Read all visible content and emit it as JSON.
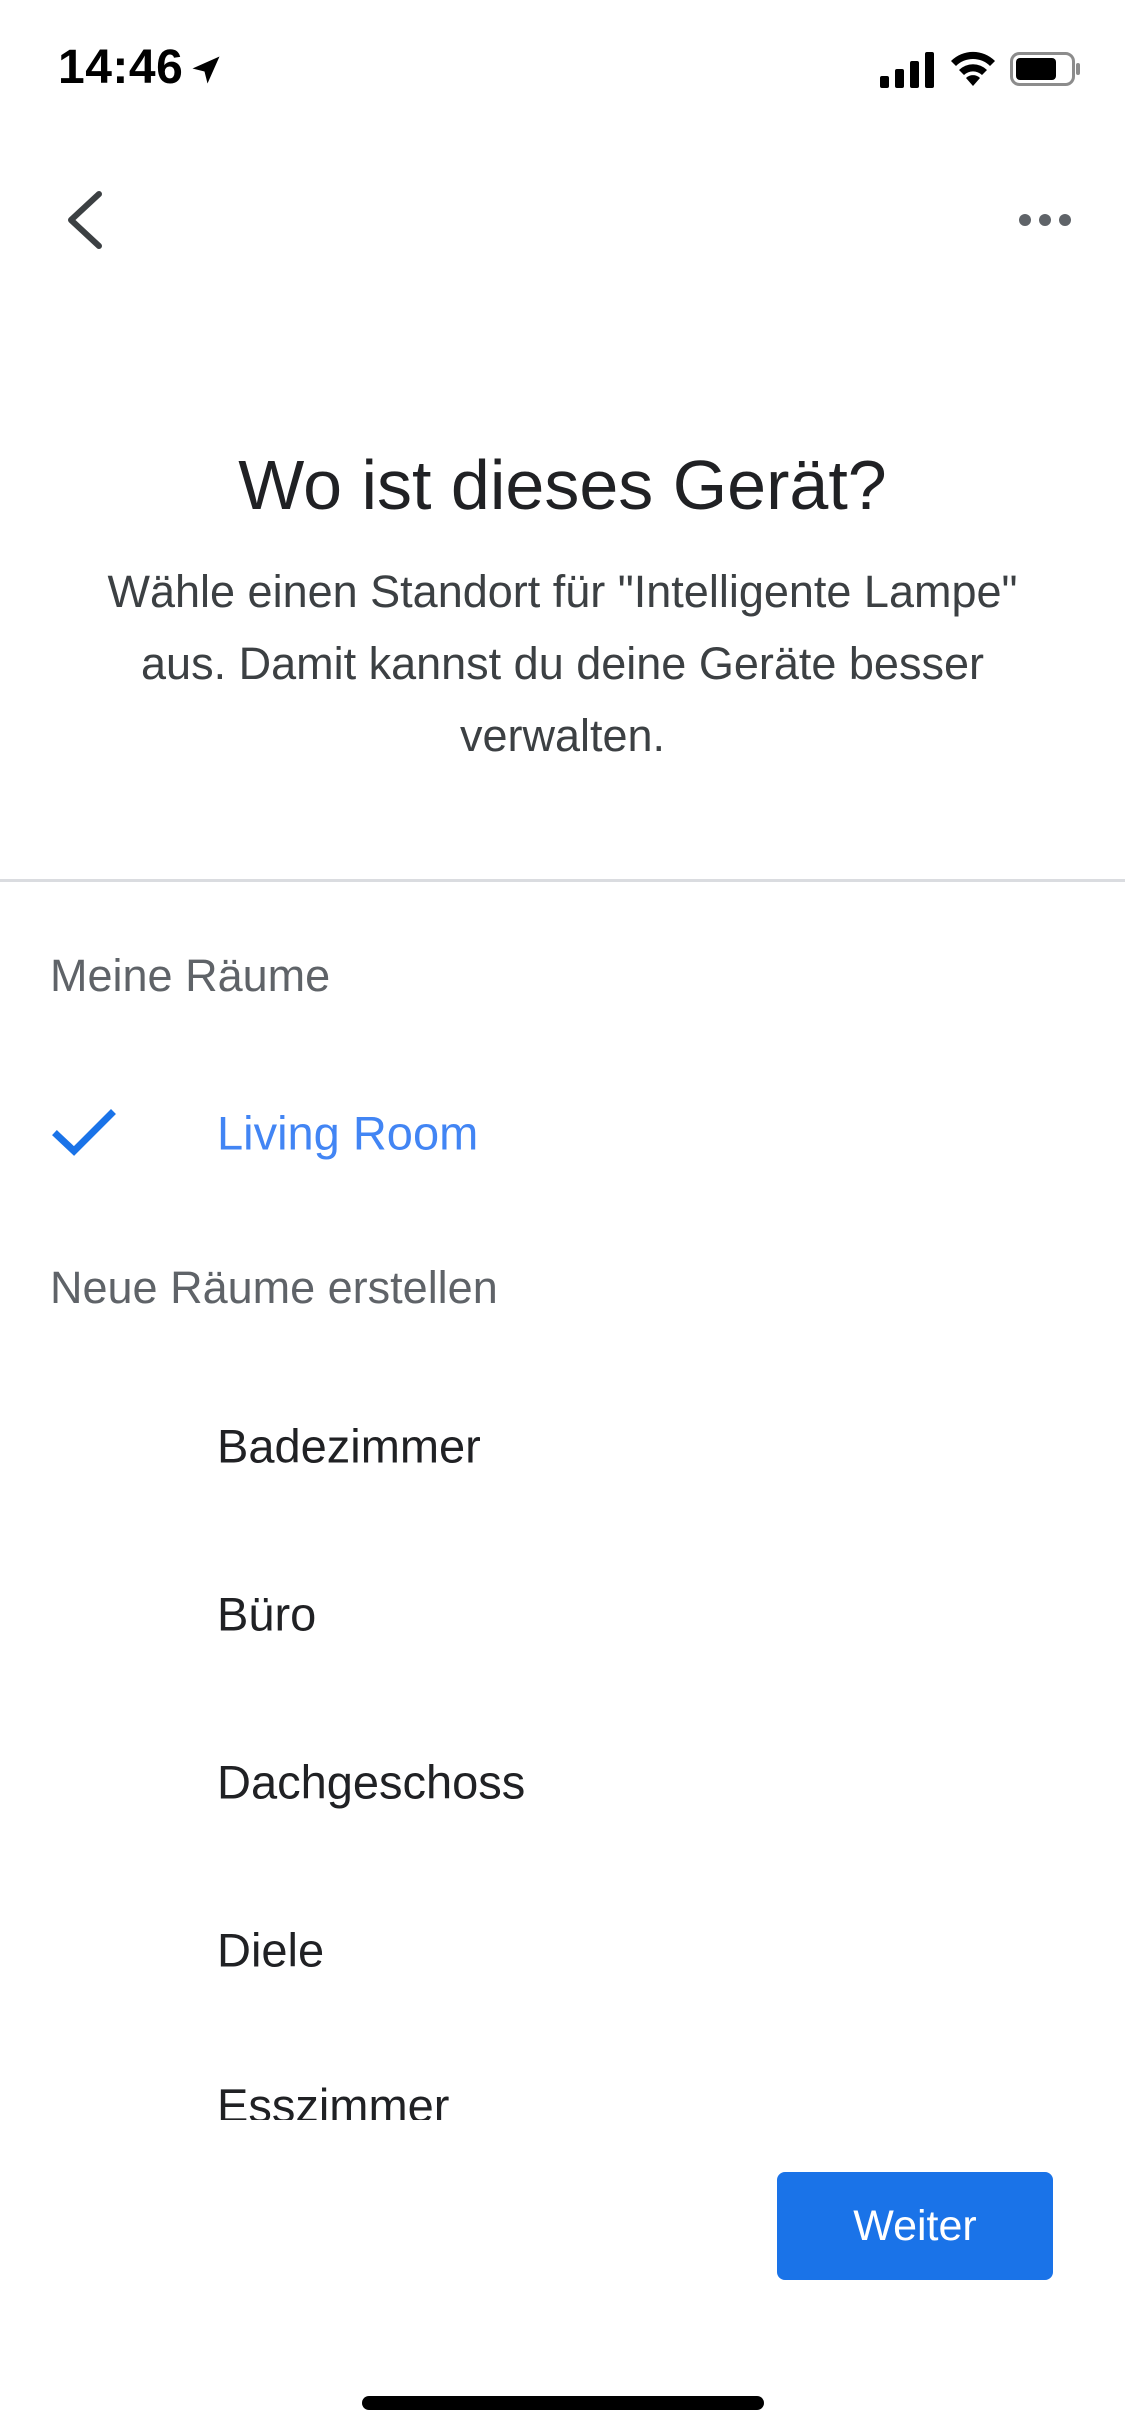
{
  "status_bar": {
    "time": "14:46",
    "icons": [
      "location-arrow-icon",
      "cellular-signal-icon",
      "wifi-icon",
      "battery-icon"
    ]
  },
  "nav": {
    "back_icon": "chevron-left-icon",
    "more_icon": "more-horizontal-icon"
  },
  "header": {
    "title": "Wo ist dieses Gerät?",
    "subtitle": "Wähle einen Standort für \"Intelligente Lampe\" aus. Damit kannst du deine Geräte besser verwalten."
  },
  "my_rooms": {
    "label": "Meine Räume",
    "items": [
      {
        "label": "Living Room",
        "selected": true
      }
    ]
  },
  "new_rooms": {
    "label": "Neue Räume erstellen",
    "items": [
      {
        "label": "Badezimmer"
      },
      {
        "label": "Büro"
      },
      {
        "label": "Dachgeschoss"
      },
      {
        "label": "Diele"
      },
      {
        "label": "Esszimmer"
      }
    ]
  },
  "actions": {
    "next_label": "Weiter"
  },
  "colors": {
    "accent": "#1a73e8",
    "selected_text": "#4285f4",
    "section_header": "#5f6368",
    "divider": "#dadce0"
  }
}
